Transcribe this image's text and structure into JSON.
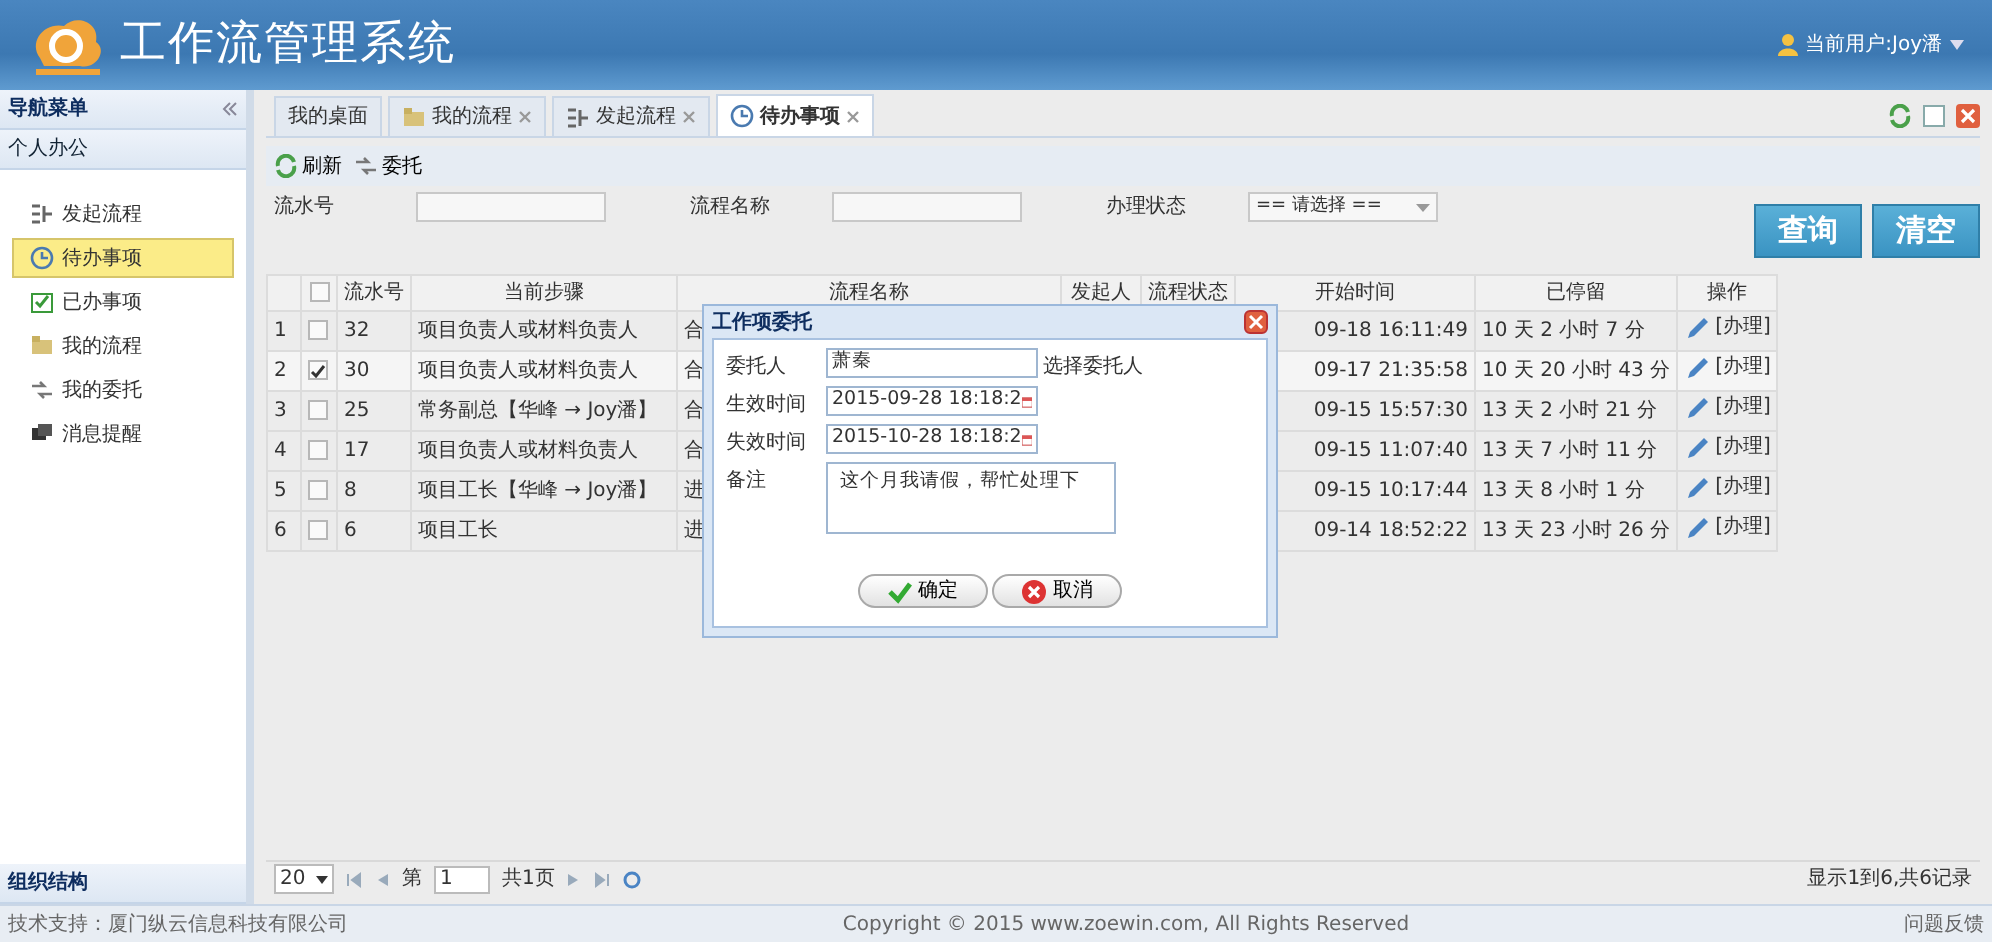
{
  "header": {
    "title": "工作流管理系统",
    "user": "当前用户:Joy潘"
  },
  "sidebar": {
    "title": "导航菜单",
    "section": "个人办公",
    "items": [
      {
        "label": "发起流程",
        "selected": false
      },
      {
        "label": "待办事项",
        "selected": true
      },
      {
        "label": "已办事项",
        "selected": false
      },
      {
        "label": "我的流程",
        "selected": false
      },
      {
        "label": "我的委托",
        "selected": false
      },
      {
        "label": "消息提醒",
        "selected": false
      }
    ],
    "bottom_section": "组织结构"
  },
  "tabs": [
    {
      "label": "我的桌面",
      "closable": false,
      "selected": false
    },
    {
      "label": "我的流程",
      "closable": true,
      "selected": false
    },
    {
      "label": "发起流程",
      "closable": true,
      "selected": false
    },
    {
      "label": "待办事项",
      "closable": true,
      "selected": true
    }
  ],
  "toolbar": [
    "刷新",
    "委托"
  ],
  "search": {
    "fields": [
      {
        "label": "流水号",
        "kind": "text"
      },
      {
        "label": "流程名称",
        "kind": "text"
      },
      {
        "label": "办理状态",
        "kind": "select",
        "value": "== 请选择 =="
      }
    ],
    "buttons": [
      "查询",
      "清空"
    ]
  },
  "table": {
    "all_checked": false,
    "columns": [
      "流水号",
      "当前步骤",
      "流程名称",
      "发起人",
      "流程状态",
      "开始时间",
      "已停留",
      "操作"
    ],
    "rows": [
      {
        "index": "1",
        "checked": false,
        "serial": "32",
        "step": "项目负责人或材料负责人",
        "name": "合",
        "start": "09-18 16:11:49",
        "stay": "10 天 2 小时 7 分",
        "action": "[办理]"
      },
      {
        "index": "2",
        "checked": true,
        "serial": "30",
        "step": "项目负责人或材料负责人",
        "name": "合",
        "start": "09-17 21:35:58",
        "stay": "10 天 20 小时 43 分",
        "action": "[办理]"
      },
      {
        "index": "3",
        "checked": false,
        "serial": "25",
        "step": "常务副总【华峰 → Joy潘】",
        "name": "合",
        "start": "09-15 15:57:30",
        "stay": "13 天 2 小时 21 分",
        "action": "[办理]"
      },
      {
        "index": "4",
        "checked": false,
        "serial": "17",
        "step": "项目负责人或材料负责人",
        "name": "合",
        "start": "09-15 11:07:40",
        "stay": "13 天 7 小时 11 分",
        "action": "[办理]"
      },
      {
        "index": "5",
        "checked": false,
        "serial": "8",
        "step": "项目工长【华峰 → Joy潘】",
        "name": "进",
        "start": "09-15 10:17:44",
        "stay": "13 天 8 小时 1 分",
        "action": "[办理]"
      },
      {
        "index": "6",
        "checked": false,
        "serial": "6",
        "step": "项目工长",
        "name": "进",
        "start": "09-14 18:52:22",
        "stay": "13 天 23 小时 26 分",
        "action": "[办理]"
      }
    ]
  },
  "pagination": {
    "page_size": "20",
    "page_prefix": "第",
    "page": "1",
    "page_total": "共1页",
    "summary": "显示1到6,共6记录"
  },
  "dialog": {
    "title": "工作项委托",
    "fields": [
      {
        "label": "委托人",
        "kind": "text",
        "value": "萧秦",
        "link": "选择委托人"
      },
      {
        "label": "生效时间",
        "kind": "date",
        "value": "2015-09-28 18:18:2"
      },
      {
        "label": "失效时间",
        "kind": "date",
        "value": "2015-10-28 18:18:2"
      },
      {
        "label": "备注",
        "kind": "textarea",
        "value": "这个月我请假，帮忙处理下"
      }
    ],
    "buttons": [
      {
        "label": "确定",
        "kind": "ok"
      },
      {
        "label": "取消",
        "kind": "cancel"
      }
    ]
  },
  "footer": {
    "support": "技术支持：厦门纵云信息科技有限公司",
    "copyright": "Copyright © 2015 www.zoewin.com, All Rights Reserved",
    "feedback": "问题反馈"
  }
}
